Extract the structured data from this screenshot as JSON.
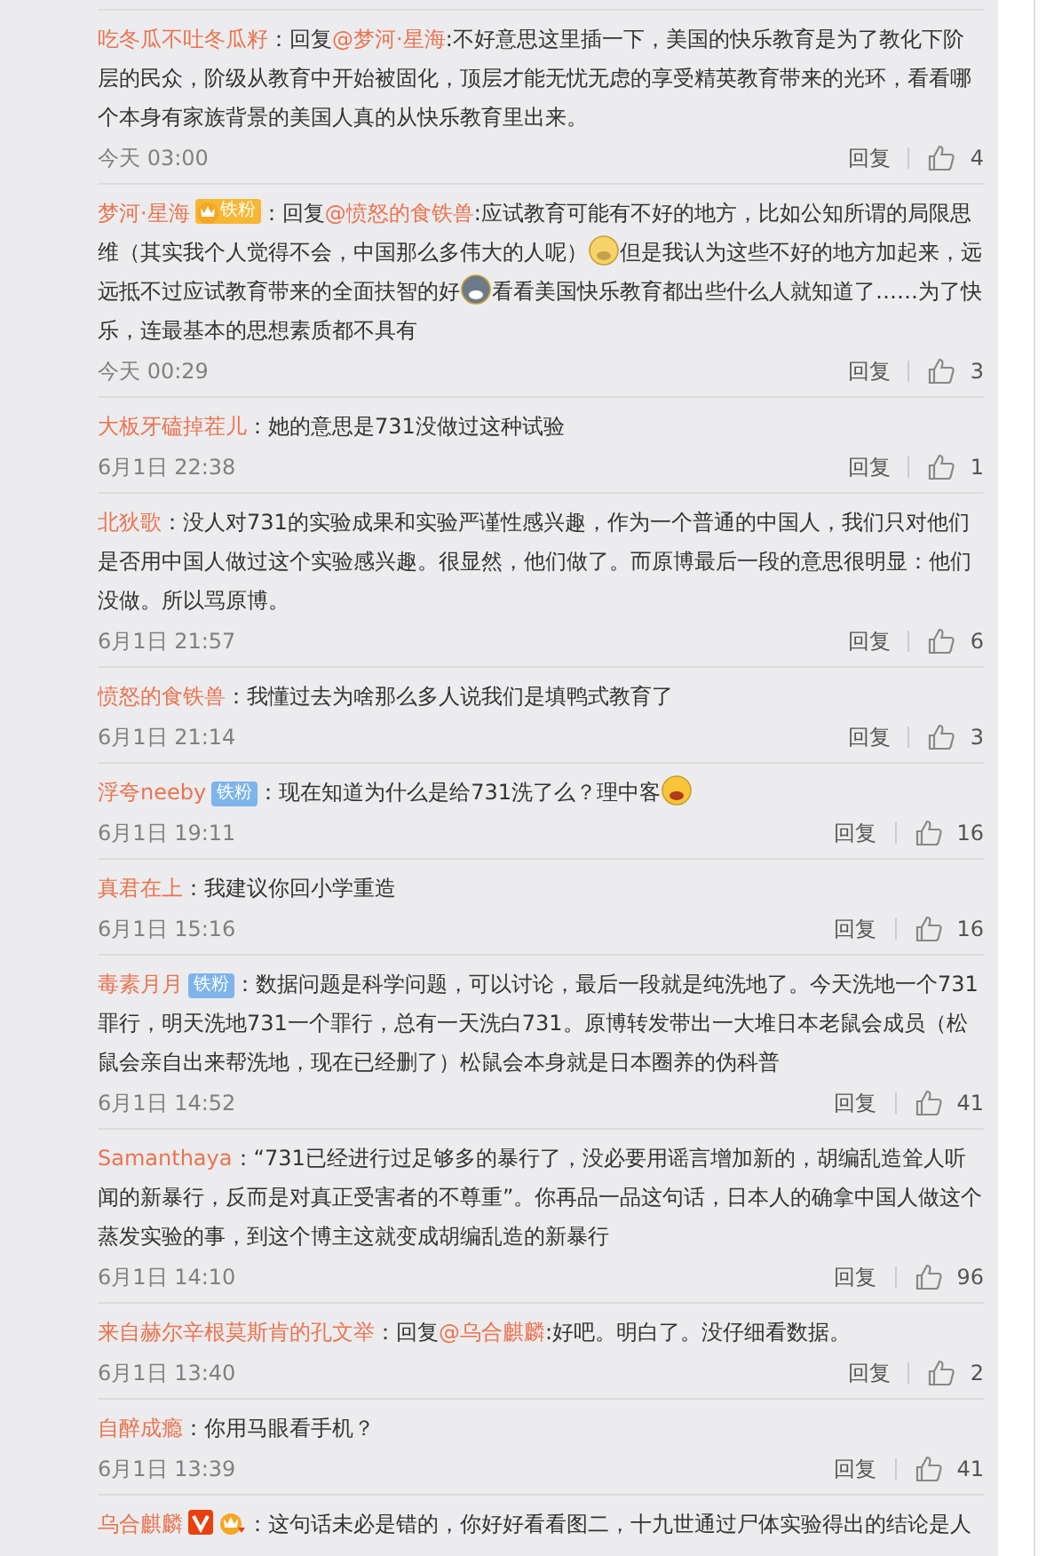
{
  "comments": [
    {
      "name": "吃冬瓜不吐冬瓜籽",
      "body": [
        {
          "kind": "text",
          "text": "：回复"
        },
        {
          "kind": "mention",
          "text": "@梦河·星海"
        },
        {
          "kind": "text",
          "text": ":不好意思这里插一下，美国的快乐教育是为了教化下阶层的民众，阶级从教育中开始被固化，顶层才能无忧无虑的享受精英教育带来的光环，看看哪个本身有家族背景的美国人真的从快乐教育里出来。"
        }
      ],
      "time": "今天 03:00",
      "reply": "回复",
      "likes": "4"
    },
    {
      "name": "梦河·星海",
      "badges": [
        {
          "kind": "crown-fan",
          "text": "铁粉"
        }
      ],
      "body": [
        {
          "kind": "text",
          "text": "：回复"
        },
        {
          "kind": "mention",
          "text": "@愤怒的食铁兽"
        },
        {
          "kind": "text",
          "text": ":应试教育可能有不好的地方，比如公知所谓的局限思维（其实我个人觉得不会，中国那么多伟大的人呢）"
        },
        {
          "kind": "doge"
        },
        {
          "kind": "text",
          "text": "但是我认为这些不好的地方加起来，远远抵不过应试教育带来的全面扶智的好"
        },
        {
          "kind": "husky"
        },
        {
          "kind": "text",
          "text": "看看美国快乐教育都出些什么人就知道了……为了快乐，连最基本的思想素质都不具有"
        }
      ],
      "time": "今天 00:29",
      "reply": "回复",
      "likes": "3"
    },
    {
      "name": "大板牙磕掉茬儿",
      "body": [
        {
          "kind": "text",
          "text": "：她的意思是731没做过这种试验"
        }
      ],
      "time": "6月1日 22:38",
      "reply": "回复",
      "likes": "1"
    },
    {
      "name": "北狄歌",
      "body": [
        {
          "kind": "text",
          "text": "：没人对731的实验成果和实验严谨性感兴趣，作为一个普通的中国人，我们只对他们是否用中国人做过这个实验感兴趣。很显然，他们做了。而原博最后一段的意思很明显：他们没做。所以骂原博。"
        }
      ],
      "time": "6月1日 21:57",
      "reply": "回复",
      "likes": "6"
    },
    {
      "name": "愤怒的食铁兽",
      "body": [
        {
          "kind": "text",
          "text": "：我懂过去为啥那么多人说我们是填鸭式教育了"
        }
      ],
      "time": "6月1日 21:14",
      "reply": "回复",
      "likes": "3"
    },
    {
      "name": "浮夸neeby",
      "badges": [
        {
          "kind": "fan",
          "text": "铁粉"
        }
      ],
      "body": [
        {
          "kind": "text",
          "text": "：现在知道为什么是给731洗了么？理中客"
        },
        {
          "kind": "laugh"
        }
      ],
      "time": "6月1日 19:11",
      "reply": "回复",
      "likes": "16"
    },
    {
      "name": "真君在上",
      "body": [
        {
          "kind": "text",
          "text": "：我建议你回小学重造"
        }
      ],
      "time": "6月1日 15:16",
      "reply": "回复",
      "likes": "16"
    },
    {
      "name": "毒素月月",
      "badges": [
        {
          "kind": "fan",
          "text": "铁粉"
        }
      ],
      "body": [
        {
          "kind": "text",
          "text": "：数据问题是科学问题，可以讨论，最后一段就是纯洗地了。今天洗地一个731罪行，明天洗地731一个罪行，总有一天洗白731。原博转发带出一大堆日本老鼠会成员（松鼠会亲自出来帮洗地，现在已经删了）松鼠会本身就是日本圈养的伪科普"
        }
      ],
      "time": "6月1日 14:52",
      "reply": "回复",
      "likes": "41"
    },
    {
      "name": "Samanthaya",
      "body": [
        {
          "kind": "text",
          "text": "：“731已经进行过足够多的暴行了，没必要用谣言增加新的，胡编乱造耸人听闻的新暴行，反而是对真正受害者的不尊重”。你再品一品这句话，日本人的确拿中国人做这个蒸发实验的事，到这个博主这就变成胡编乱造的新暴行"
        }
      ],
      "time": "6月1日 14:10",
      "reply": "回复",
      "likes": "96"
    },
    {
      "name": "来自赫尔辛根莫斯肯的孔文举",
      "body": [
        {
          "kind": "text",
          "text": "：回复"
        },
        {
          "kind": "mention",
          "text": "@乌合麒麟"
        },
        {
          "kind": "text",
          "text": ":好吧。明白了。没仔细看数据。"
        }
      ],
      "time": "6月1日 13:40",
      "reply": "回复",
      "likes": "2"
    },
    {
      "name": "自醉成瘾",
      "body": [
        {
          "kind": "text",
          "text": "：你用马眼看手机？"
        }
      ],
      "time": "6月1日 13:39",
      "reply": "回复",
      "likes": "41"
    },
    {
      "name": "乌合麒麟",
      "badges": [
        {
          "kind": "verified"
        },
        {
          "kind": "crown"
        }
      ],
      "body": [
        {
          "kind": "text",
          "text": "：这句话未必是错的，你好好看看图二，十九世通过尸体实验得出的结论是人"
        }
      ]
    }
  ]
}
